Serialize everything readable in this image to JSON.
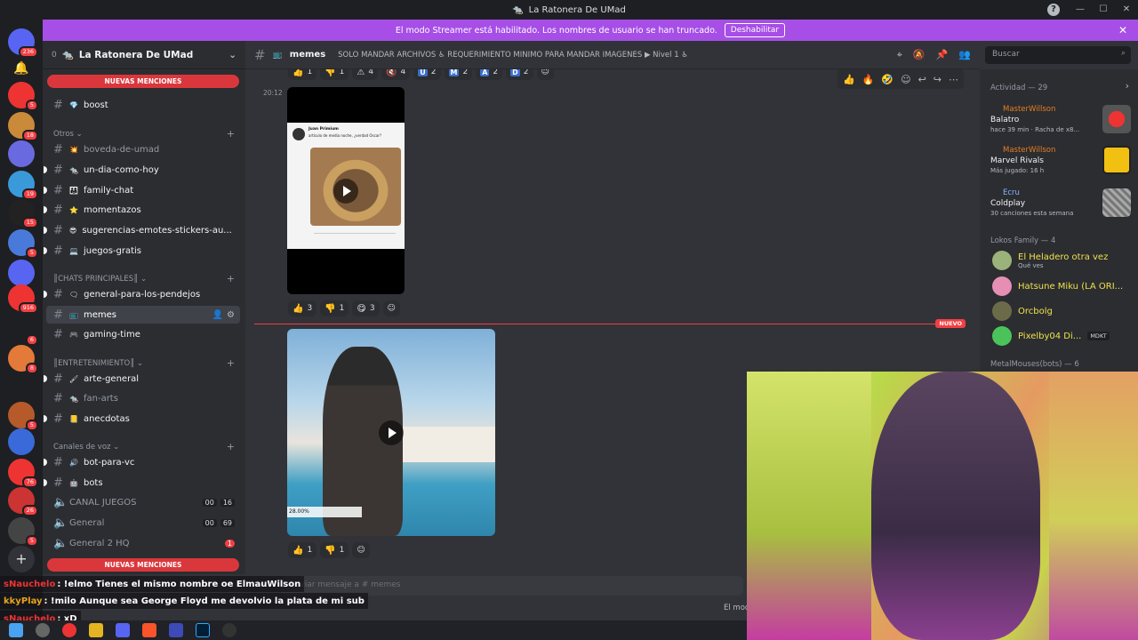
{
  "window": {
    "title": "La Ratonera De UMad"
  },
  "banner": {
    "text": "El modo Streamer está habilitado. Los nombres de usuario se han truncado.",
    "button": "Deshabilitar"
  },
  "servers": [
    {
      "badge": "236"
    },
    {
      "badge": ""
    },
    {
      "badge": "5"
    },
    {
      "badge": "18"
    },
    {
      "badge": ""
    },
    {
      "badge": "19"
    },
    {
      "badge": "15"
    },
    {
      "badge": "5"
    },
    {
      "badge": ""
    },
    {
      "badge": "916"
    },
    {
      "badge": "6"
    },
    {
      "badge": "8"
    },
    {
      "badge": ""
    },
    {
      "badge": "5"
    },
    {
      "badge": ""
    },
    {
      "badge": "76"
    },
    {
      "badge": "26"
    },
    {
      "badge": "5"
    }
  ],
  "sidebar": {
    "server_name": "La Ratonera De UMad",
    "server_count": "0",
    "mentions_label": "NUEVAS MENCIONES",
    "channels": [
      {
        "name": "boost",
        "emoji": "💎"
      },
      {
        "name": "boveda-de-umad",
        "emoji": "💥"
      },
      {
        "name": "un-dia-como-hoy",
        "emoji": "🐀"
      },
      {
        "name": "family-chat",
        "emoji": "👨‍👩‍👧"
      },
      {
        "name": "momentazos",
        "emoji": "⭐"
      },
      {
        "name": "sugerencias-emotes-stickers-au...",
        "emoji": "😎"
      },
      {
        "name": "juegos-gratis",
        "emoji": "💻"
      },
      {
        "name": "general-para-los-pendejos",
        "emoji": "🗨"
      },
      {
        "name": "memes",
        "emoji": "📺"
      },
      {
        "name": "gaming-time",
        "emoji": "🎮"
      },
      {
        "name": "arte-general",
        "emoji": "🖌"
      },
      {
        "name": "fan-arts",
        "emoji": "🐀"
      },
      {
        "name": "anecdotas",
        "emoji": "📒"
      },
      {
        "name": "bot-para-vc",
        "emoji": "🔊"
      },
      {
        "name": "bots",
        "emoji": "🤖"
      }
    ],
    "categories": {
      "otros": "Otros",
      "chats": "CHATS PRINCIPALES",
      "entretenimiento": "ENTRETENIMIENTO",
      "voz": "Canales de voz"
    },
    "voice": [
      {
        "name": "CANAL JUEGOS",
        "a": "00",
        "b": "16"
      },
      {
        "name": "General",
        "a": "00",
        "b": "69"
      },
      {
        "name": "General 2 HQ",
        "a": "",
        "b": "1"
      }
    ]
  },
  "header": {
    "channel": "memes",
    "topic": "SOLO MANDAR ARCHIVOS ♿ REQUERIMIENTO MINIMO PARA MANDAR IMAGENES ▶ Nivel 1 ♿",
    "search_placeholder": "Buscar"
  },
  "messages": {
    "timestamp": "20:12",
    "top_reactions": [
      {
        "icon": "👍",
        "count": "1"
      },
      {
        "icon": "👎",
        "count": "1"
      },
      {
        "icon": "⚠",
        "count": "4"
      },
      {
        "icon": "🔇",
        "count": "4"
      },
      {
        "icon": "U",
        "count": "2"
      },
      {
        "icon": "M",
        "count": "2"
      },
      {
        "icon": "A",
        "count": "2"
      },
      {
        "icon": "D",
        "count": "2"
      }
    ],
    "reactions1": [
      {
        "icon": "👍",
        "count": "3"
      },
      {
        "icon": "👎",
        "count": "1"
      },
      {
        "icon": "😋",
        "count": "3"
      }
    ],
    "reactions2": [
      {
        "icon": "👍",
        "count": "1"
      },
      {
        "icon": "👎",
        "count": "1"
      }
    ],
    "new_label": "NUEVO",
    "post1": {
      "author": "Juan Primium",
      "text": "artículo de media noche, ¿verdad Oscar?"
    },
    "post2": {
      "caption": "28.00%"
    }
  },
  "composer": {
    "placeholder": "Enviar mensaje a #",
    "channel": "memes",
    "right_text": "El mod"
  },
  "members": {
    "activity_header": "Actividad — 29",
    "activities": [
      {
        "user": "MasterWillson",
        "game": "Balatro",
        "sub": "hace 39 min · Racha de x8..."
      },
      {
        "user": "MasterWillson",
        "game": "Marvel Rivals",
        "sub": "Más jugado: 16 h"
      },
      {
        "user": "Ecru",
        "game": "Coldplay",
        "sub": "30 canciones esta semana"
      }
    ],
    "group1": "Lokos Family — 4",
    "list": [
      {
        "name": "El Heladero otra vez",
        "sub": "Qué ves",
        "color": "#f0e14a"
      },
      {
        "name": "Hatsune Miku (LA ORI...",
        "sub": "",
        "color": "#f2f3f5"
      },
      {
        "name": "Orcbolg",
        "sub": "",
        "color": "#f2f3f5"
      },
      {
        "name": "Pixelby04 Di...",
        "sub": "",
        "color": "#f0e14a",
        "tag": "MDKT"
      }
    ],
    "group2": "MetalMouses(bots) — 6"
  },
  "chat_overlay": [
    {
      "user": "sNauchelo",
      "text": ": !elmo Tienes el mismo nombre oe ElmauWilson"
    },
    {
      "user": "kkyPlay",
      "text": ": !milo Aunque sea George Floyd me devolvio la plata de mi sub"
    },
    {
      "user": "sNauchelo",
      "text": ": xD"
    }
  ]
}
